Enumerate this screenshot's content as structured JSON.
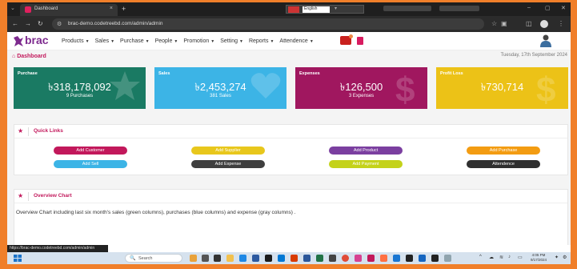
{
  "browser": {
    "tab_title": "Dashboard",
    "tab_close": "×",
    "new_tab": "+",
    "language": "English",
    "url": "brac-demo.codetreebd.com/admin/admin",
    "status_url": "https://brac-demo.codetreebd.com/admin/admin"
  },
  "app": {
    "logo_text": "brac",
    "menu": [
      {
        "label": "Products"
      },
      {
        "label": "Sales"
      },
      {
        "label": "Purchase"
      },
      {
        "label": "People"
      },
      {
        "label": "Promotion"
      },
      {
        "label": "Setting"
      },
      {
        "label": "Reports"
      },
      {
        "label": "Attendence"
      }
    ]
  },
  "dashboard": {
    "title": "Dashboard",
    "date": "Tuesday, 17th September 2024",
    "cards": {
      "purchase": {
        "label": "Purchase",
        "amount": "৳318,178,092",
        "sub": "9 Purchases",
        "color": "#1a7a63"
      },
      "sales": {
        "label": "Sales",
        "amount": "৳2,453,274",
        "sub": "381 Sales",
        "color": "#3cb4e6"
      },
      "expense": {
        "label": "Expenses",
        "amount": "৳126,500",
        "sub": "3 Expenses",
        "color": "#a0175f"
      },
      "profit": {
        "label": "Profit Loss",
        "amount": "৳730,714",
        "sub": "",
        "color": "#ecc217"
      }
    },
    "quick_links": {
      "title": "Quick Links",
      "buttons": {
        "add_customer": "Add Customer",
        "add_supplier": "Add Supplier",
        "add_product": "Add Product",
        "add_purchase": "Add Purchase",
        "add_sell": "Add Sell",
        "add_expense": "Add Expense",
        "add_payment": "Add Payment",
        "attendence": "Attendence"
      }
    },
    "overview": {
      "title": "Overview Chart",
      "description": "Overview Chart including last six month's sales (green columns), purchases (blue columns) and expense (gray columns) ."
    }
  },
  "taskbar": {
    "search_placeholder": "Search",
    "time": "4:05 PM",
    "date": "9/17/2024"
  }
}
